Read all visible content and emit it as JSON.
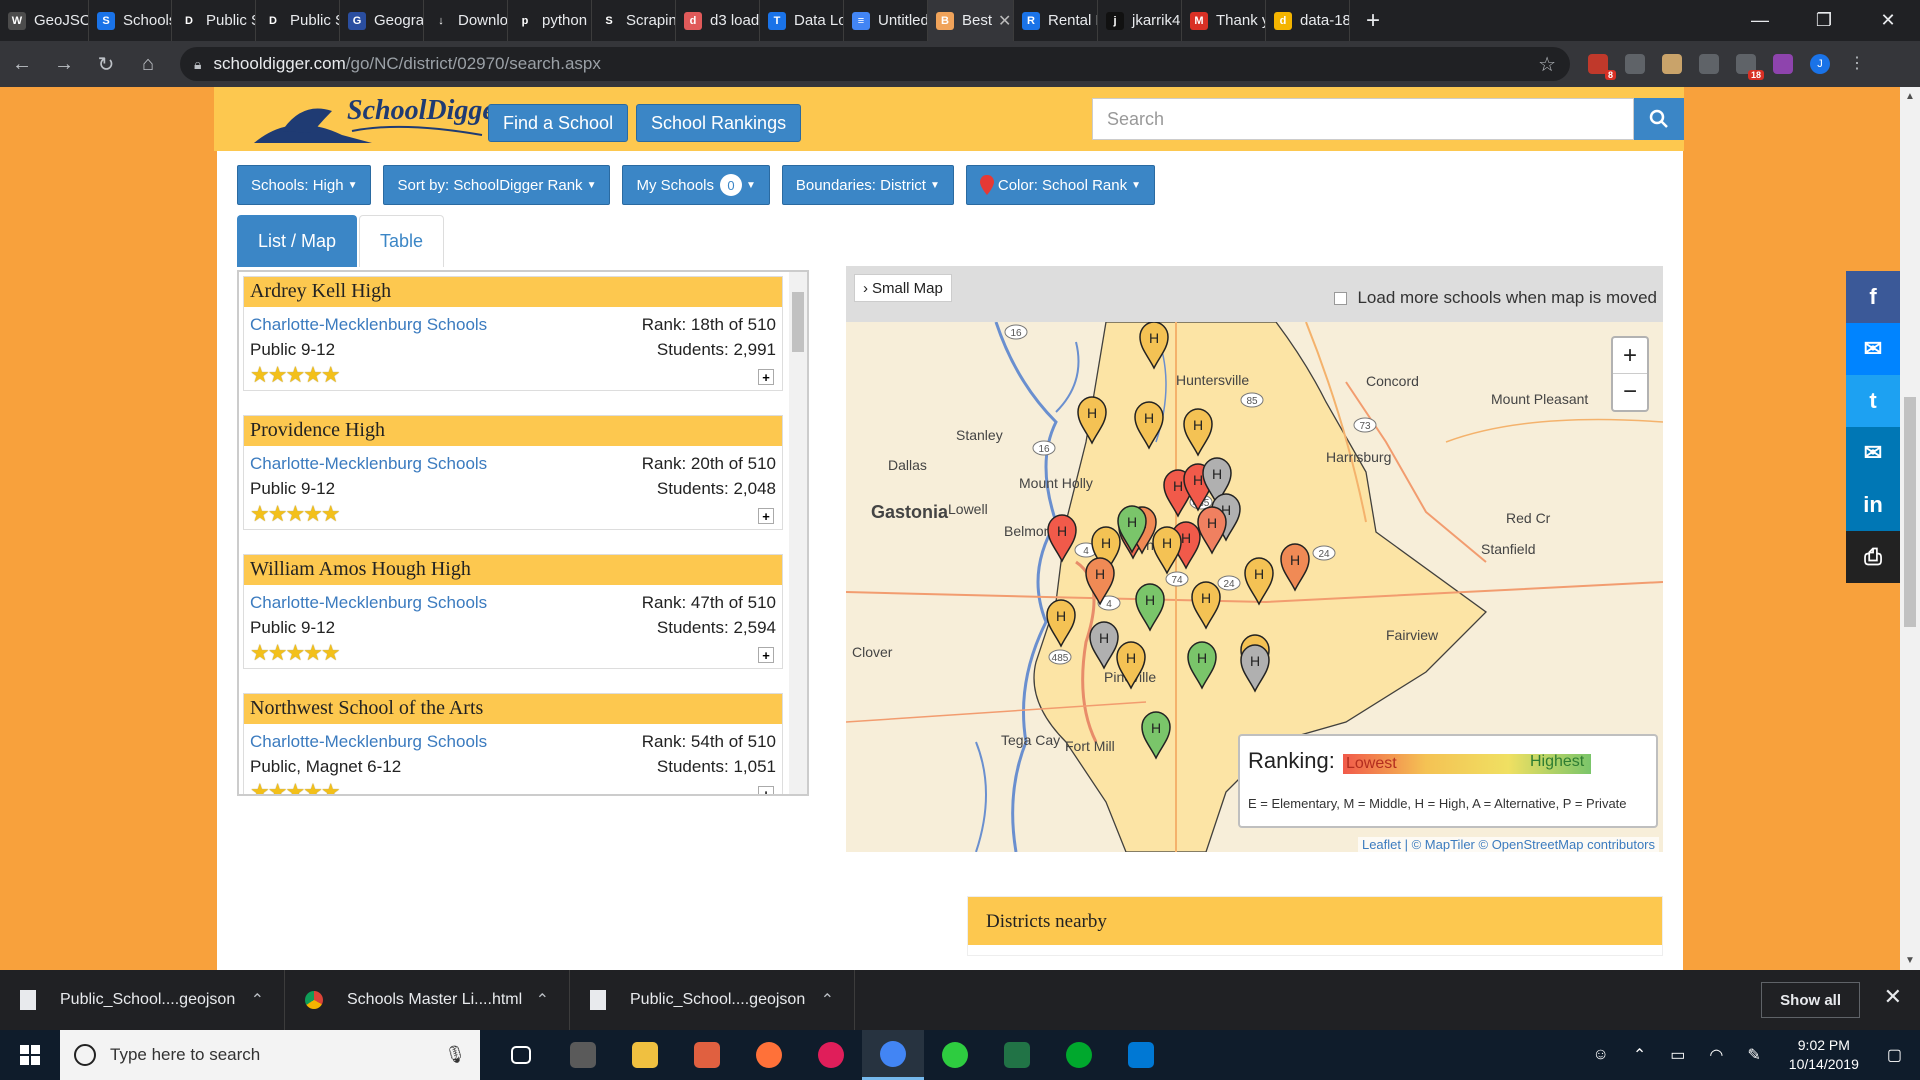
{
  "tabs": [
    {
      "label": "GeoJSO",
      "color": "#4c4c4c",
      "glyph": "W"
    },
    {
      "label": "Schools",
      "color": "#1a73e8",
      "glyph": "S"
    },
    {
      "label": "Public S",
      "color": "#202124",
      "glyph": "D"
    },
    {
      "label": "Public S",
      "color": "#202124",
      "glyph": "D"
    },
    {
      "label": "Geogra",
      "color": "#2a4ea0",
      "glyph": "G"
    },
    {
      "label": "Downlo",
      "color": "#202124",
      "glyph": "↓"
    },
    {
      "label": "python",
      "color": "#202124",
      "glyph": "p"
    },
    {
      "label": "Scrapin",
      "color": "#202124",
      "glyph": "S"
    },
    {
      "label": "d3 load",
      "color": "#e05a5a",
      "glyph": "d"
    },
    {
      "label": "Data Lo",
      "color": "#1a73e8",
      "glyph": "T"
    },
    {
      "label": "Untitled",
      "color": "#4285f4",
      "glyph": "≡"
    },
    {
      "label": "Best",
      "color": "#f0a35a",
      "glyph": "B"
    },
    {
      "label": "Rental L",
      "color": "#1a73e8",
      "glyph": "R"
    },
    {
      "label": "jkarrik4",
      "color": "#111111",
      "glyph": "j"
    },
    {
      "label": "Thank y",
      "color": "#d93025",
      "glyph": "M"
    },
    {
      "label": "data-18",
      "color": "#f4b400",
      "glyph": "d"
    }
  ],
  "active_tab": 11,
  "url": {
    "host": "schooldigger.com",
    "path": "/go/NC/district/02970/search.aspx"
  },
  "extensions": {
    "abp_badge": "8",
    "mail_badge": "18",
    "avatar": "J"
  },
  "site": {
    "logo_text": "SchoolDigger",
    "find_school": "Find a School",
    "school_rankings": "School Rankings",
    "search_placeholder": "Search"
  },
  "filters": {
    "schools": "Schools: High",
    "sort": "Sort by: SchoolDigger Rank",
    "my_schools": "My Schools",
    "my_schools_count": "0",
    "boundaries": "Boundaries: District",
    "color": "Color: School Rank"
  },
  "view_tabs": {
    "list_map": "List / Map",
    "table": "Table"
  },
  "schools": [
    {
      "name": "Ardrey Kell High",
      "district": "Charlotte-Mecklenburg Schools",
      "rank": "Rank: 18th of 510",
      "type": "Public 9-12",
      "students": "Students: 2,991",
      "stars": "★★★★★"
    },
    {
      "name": "Providence High",
      "district": "Charlotte-Mecklenburg Schools",
      "rank": "Rank: 20th of 510",
      "type": "Public 9-12",
      "students": "Students: 2,048",
      "stars": "★★★★★"
    },
    {
      "name": "William Amos Hough High",
      "district": "Charlotte-Mecklenburg Schools",
      "rank": "Rank: 47th of 510",
      "type": "Public 9-12",
      "students": "Students: 2,594",
      "stars": "★★★★★"
    },
    {
      "name": "Northwest School of the Arts",
      "district": "Charlotte-Mecklenburg Schools",
      "rank": "Rank: 54th of 510",
      "type": "Public, Magnet 6-12",
      "students": "Students: 1,051",
      "stars": "★★★★★"
    }
  ],
  "map": {
    "small_map": "Small Map",
    "load_more": "Load more schools when map is moved",
    "zoom_in": "+",
    "zoom_out": "−",
    "places": [
      "Huntersville",
      "Concord",
      "Mount Pleasant",
      "Stanley",
      "Harrisburg",
      "Dallas",
      "Mount Holly",
      "Gastonia",
      "Lowell",
      "Belmont",
      "Charlotte",
      "Red Cr",
      "Stanfield",
      "Clover",
      "Fairview",
      "Pineville",
      "Tega Cay",
      "Fort Mill"
    ],
    "routes": [
      "16",
      "85",
      "73",
      "16",
      "485",
      "4",
      "74",
      "24",
      "4",
      "485",
      "24"
    ],
    "legend_title": "Ranking:",
    "legend_low": "Lowest",
    "legend_high": "Highest",
    "legend_key": "E = Elementary, M = Middle, H = High, A = Alternative, P = Private",
    "attribution_leaflet": "Leaflet",
    "attribution_rest": " | © MapTiler © OpenStreetMap contributors",
    "pin_letter": "H",
    "pin_colors": [
      "#f4c254",
      "#f4c254",
      "#f4c254",
      "#f4c254",
      "#f15a4a",
      "#f15a4a",
      "#b0b0b0",
      "#b0b0b0",
      "#f15a4a",
      "#f06a50",
      "#f08a55",
      "#7ac56a",
      "#f4c254",
      "#f15a4a",
      "#f08060",
      "#f4c254",
      "#f08a55",
      "#f4c254",
      "#f08a55",
      "#7ac56a",
      "#f4c254",
      "#f4c254",
      "#b0b0b0",
      "#f4c254",
      "#7ac56a",
      "#f4c254",
      "#b0b0b0",
      "#7ac56a"
    ]
  },
  "nearby_title": "Districts nearby",
  "social": [
    {
      "name": "facebook",
      "label": "f",
      "color": "#3b5998"
    },
    {
      "name": "messenger",
      "label": "✉",
      "color": "#0084ff"
    },
    {
      "name": "twitter",
      "label": "t",
      "color": "#1da1f2"
    },
    {
      "name": "email",
      "label": "✉",
      "color": "#0077b5"
    },
    {
      "name": "linkedin",
      "label": "in",
      "color": "#0077b5"
    },
    {
      "name": "print",
      "label": "⎙",
      "color": "#222222"
    }
  ],
  "downloads": [
    {
      "name": "Public_School....geojson",
      "kind": "file"
    },
    {
      "name": "Schools Master Li....html",
      "kind": "chrome"
    },
    {
      "name": "Public_School....geojson",
      "kind": "file"
    }
  ],
  "show_all": "Show all",
  "taskbar": {
    "search_placeholder": "Type here to search",
    "time": "9:02 PM",
    "date": "10/14/2019",
    "apps": [
      "task-view",
      "calculator",
      "file-explorer",
      "git",
      "firefox",
      "slack",
      "chrome",
      "sync",
      "excel",
      "evernote",
      "vscode"
    ],
    "app_colors": [
      "#ffffff",
      "#5a5a5a",
      "#f0c040",
      "#e06040",
      "#ff7139",
      "#e01e5a",
      "#4285f4",
      "#2ecc40",
      "#217346",
      "#00a82d",
      "#0078d4"
    ]
  }
}
